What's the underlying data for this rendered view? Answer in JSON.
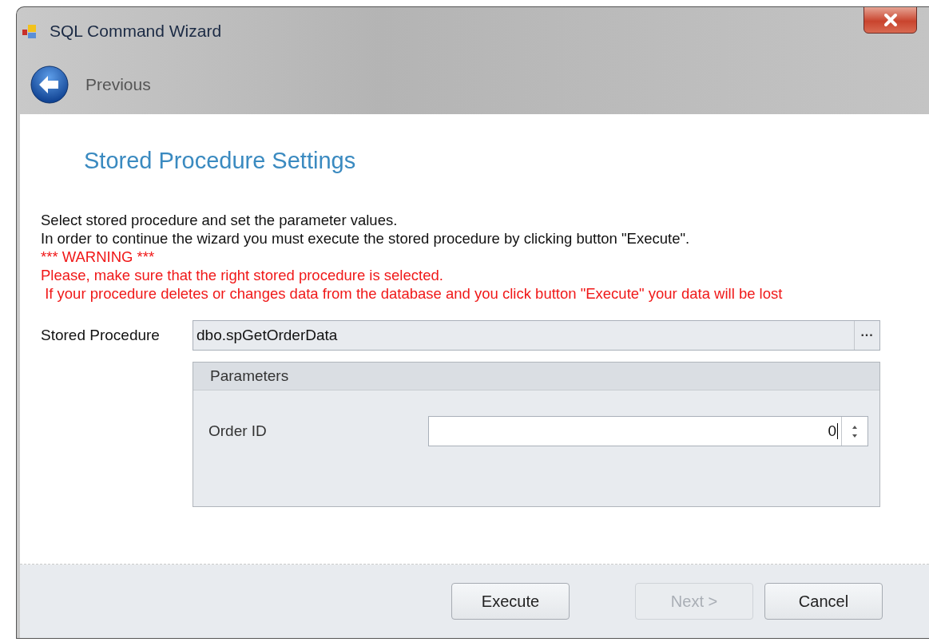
{
  "window": {
    "title": "SQL Command Wizard"
  },
  "navigation": {
    "back_label": "Previous"
  },
  "page": {
    "title": "Stored Procedure Settings",
    "messages": [
      {
        "text": "Select stored procedure and set the parameter values.",
        "kind": "info"
      },
      {
        "text": "In order to continue the wizard you must execute the stored procedure by clicking button \"Execute\".",
        "kind": "info"
      },
      {
        "text": "*** WARNING ***",
        "kind": "warning"
      },
      {
        "text": "Please, make sure that the right stored procedure is selected.",
        "kind": "warning"
      },
      {
        "text": " If your procedure deletes or changes data from the database and you click button \"Execute\" your data will be lost",
        "kind": "warning"
      }
    ],
    "stored_procedure": {
      "label": "Stored Procedure",
      "value": "dbo.spGetOrderData",
      "browse_button": "···"
    },
    "parameters": {
      "title": "Parameters",
      "items": [
        {
          "label": "Order ID",
          "value": "0"
        }
      ]
    }
  },
  "buttons": [
    {
      "label": "Execute",
      "disabled": false
    },
    {
      "label": "Next >",
      "disabled": true
    },
    {
      "label": "Cancel",
      "disabled": false
    }
  ]
}
